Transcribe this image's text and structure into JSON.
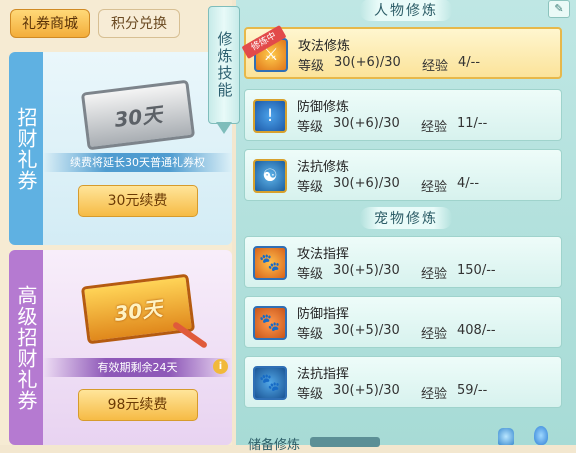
{
  "shop": {
    "tabs": [
      "礼券商城",
      "积分兑换"
    ],
    "cards": [
      {
        "label": "招财礼券",
        "ticket_text": "30天",
        "note": "续费将延长30天普通礼券权",
        "button": "30元续费"
      },
      {
        "label": "高级招财礼券",
        "ticket_text": "30天",
        "note": "有效期剩余24天",
        "info": "i",
        "button": "98元续费"
      }
    ]
  },
  "banner": {
    "text": "修炼技能"
  },
  "skills": {
    "section_character": "人物修炼",
    "section_pet": "宠物修炼",
    "level_label": "等级",
    "exp_label": "经验",
    "badge_training": "修炼中",
    "character": [
      {
        "name": "攻法修炼",
        "level": "30(+6)/30",
        "exp": "4/--",
        "icon": "attack-sword-icon"
      },
      {
        "name": "防御修炼",
        "level": "30(+6)/30",
        "exp": "11/--",
        "icon": "defense-shield-icon"
      },
      {
        "name": "法抗修炼",
        "level": "30(+6)/30",
        "exp": "4/--",
        "icon": "resist-swirl-icon"
      }
    ],
    "pet": [
      {
        "name": "攻法指挥",
        "level": "30(+5)/30",
        "exp": "150/--",
        "icon": "pet-attack-paw-icon"
      },
      {
        "name": "防御指挥",
        "level": "30(+5)/30",
        "exp": "408/--",
        "icon": "pet-defense-paw-icon"
      },
      {
        "name": "法抗指挥",
        "level": "30(+5)/30",
        "exp": "59/--",
        "icon": "pet-resist-paw-icon"
      }
    ],
    "reserve_label": "储备修炼"
  },
  "colors": {
    "accent_gold": "#f3ad3a",
    "panel_teal": "#bfe7e4",
    "card_blue": "#5fb1e2",
    "card_purple": "#b57ad1"
  }
}
